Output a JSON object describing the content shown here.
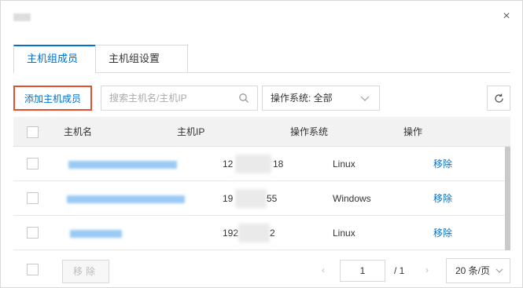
{
  "dialog": {
    "close_glyph": "×"
  },
  "tabs": [
    {
      "label": "主机组成员",
      "active": true
    },
    {
      "label": "主机组设置",
      "active": false
    }
  ],
  "toolbar": {
    "add_label": "添加主机成员",
    "search_placeholder": "搜索主机名/主机IP",
    "os_filter_label": "操作系统: 全部"
  },
  "table": {
    "headers": {
      "name": "主机名",
      "ip": "主机IP",
      "os": "操作系统",
      "action": "操作"
    },
    "rows": [
      {
        "ip_prefix": "12",
        "ip_suffix": "18",
        "os": "Linux",
        "action": "移除"
      },
      {
        "ip_prefix": "19",
        "ip_suffix": "55",
        "os": "Windows",
        "action": "移除"
      },
      {
        "ip_prefix": "192",
        "ip_suffix": "2",
        "os": "Linux",
        "action": "移除"
      }
    ]
  },
  "footer": {
    "remove_label": "移除",
    "prev_glyph": "‹",
    "next_glyph": "›",
    "current_page": "1",
    "total_pages": "/ 1",
    "page_size_label": "20 条/页"
  },
  "colors": {
    "accent": "#0070cc",
    "highlight_border": "#e34f2f"
  },
  "icons": [
    "close-icon",
    "search-icon",
    "chevron-down-icon",
    "refresh-icon"
  ]
}
